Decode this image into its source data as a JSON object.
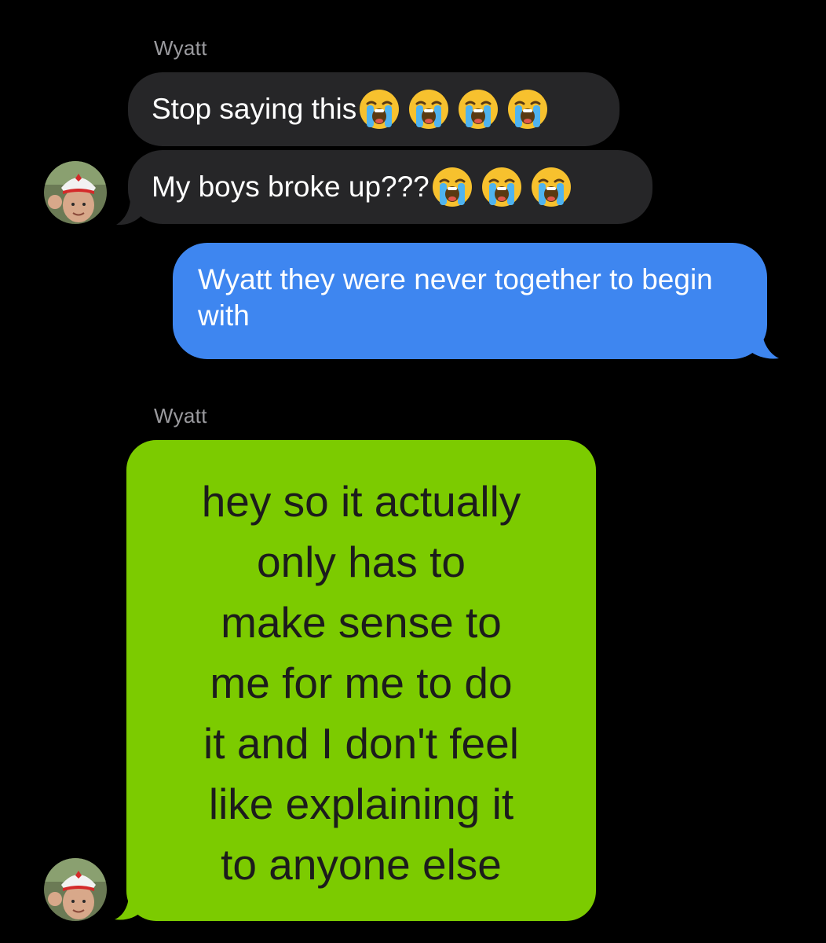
{
  "conversation": {
    "contact_name": "Wyatt",
    "colors": {
      "background": "#000000",
      "incoming_bubble": "#262628",
      "outgoing_bubble": "#3e86f0",
      "image_bubble": "#7ccb00",
      "sender_label": "#9a9a9e"
    },
    "messages": [
      {
        "direction": "incoming",
        "sender": "Wyatt",
        "text": "Stop saying this",
        "emojis": [
          "loudly-crying-face",
          "loudly-crying-face",
          "loudly-crying-face",
          "loudly-crying-face"
        ]
      },
      {
        "direction": "incoming",
        "text": "My boys broke up???",
        "emojis": [
          "loudly-crying-face",
          "loudly-crying-face",
          "loudly-crying-face"
        ]
      },
      {
        "direction": "outgoing",
        "text": "Wyatt they were never together to begin with"
      },
      {
        "direction": "incoming",
        "sender": "Wyatt",
        "type": "image",
        "lines": [
          "hey so it actually",
          "only has to",
          "make sense to",
          "me for me to do",
          "it and I don't feel",
          "like explaining it",
          "to anyone else"
        ]
      }
    ]
  }
}
